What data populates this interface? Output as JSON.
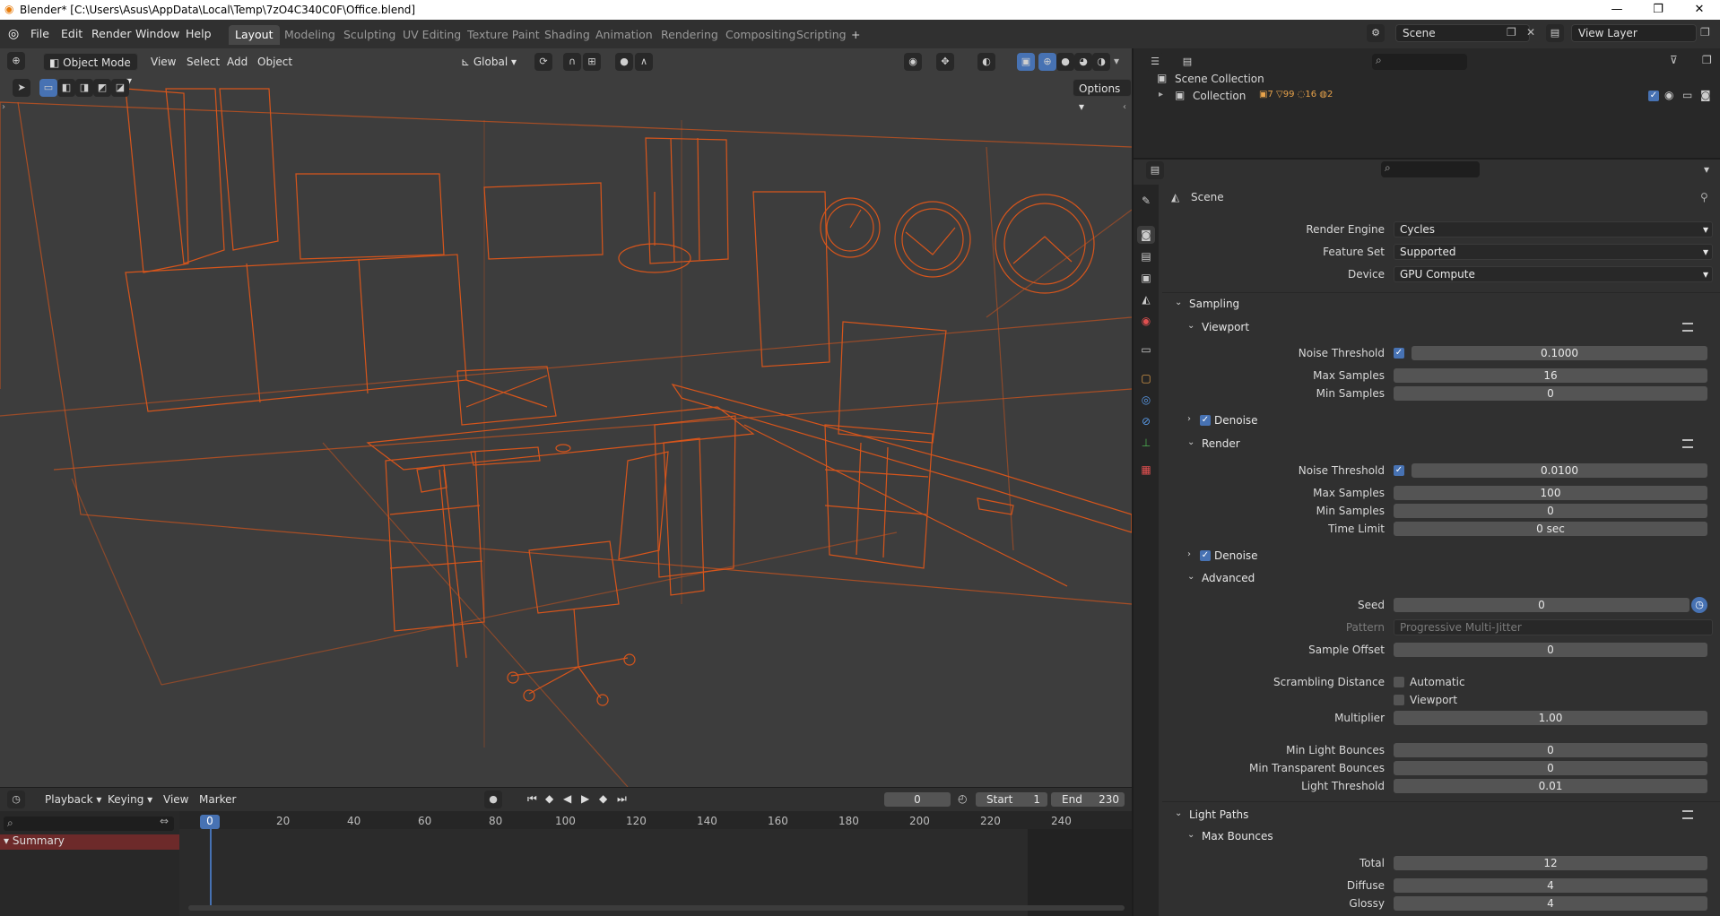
{
  "window": {
    "title": "Blender* [C:\\Users\\Asus\\AppData\\Local\\Temp\\7zO4C340C0F\\Office.blend]",
    "controls": [
      "—",
      "❐",
      "✕"
    ]
  },
  "menu": [
    "File",
    "Edit",
    "Render",
    "Window",
    "Help"
  ],
  "workspaces": [
    "Layout",
    "Modeling",
    "Sculpting",
    "UV Editing",
    "Texture Paint",
    "Shading",
    "Animation",
    "Rendering",
    "Compositing",
    "Scripting"
  ],
  "add_workspace": "+",
  "scene_selector": "Scene",
  "view_layer": "View Layer",
  "viewport": {
    "mode": "Object Mode",
    "menus": [
      "View",
      "Select",
      "Add",
      "Object"
    ],
    "transform_orientation": "Global",
    "options": "Options",
    "wire_color": "#e0571a"
  },
  "timeline": {
    "menus": [
      "Playback",
      "Keying",
      "View",
      "Marker"
    ],
    "current_frame": "0",
    "start_label": "Start",
    "start": "1",
    "end_label": "End",
    "end": "230",
    "ruler": [
      "0",
      "20",
      "40",
      "60",
      "80",
      "100",
      "120",
      "140",
      "160",
      "180",
      "200",
      "220",
      "240"
    ],
    "summary": "Summary"
  },
  "outliner": {
    "scene_collection": "Scene Collection",
    "collection": "Collection",
    "counts": [
      "7",
      "99",
      "16",
      "2"
    ]
  },
  "properties": {
    "scene": "Scene",
    "render_engine_label": "Render Engine",
    "render_engine": "Cycles",
    "feature_set_label": "Feature Set",
    "feature_set": "Supported",
    "device_label": "Device",
    "device": "GPU Compute",
    "sampling": "Sampling",
    "viewport": "Viewport",
    "noise_threshold_label": "Noise Threshold",
    "vp_noise_threshold": "0.1000",
    "max_samples_label": "Max Samples",
    "vp_max_samples": "16",
    "min_samples_label": "Min Samples",
    "vp_min_samples": "0",
    "denoise": "Denoise",
    "render": "Render",
    "r_noise_threshold": "0.0100",
    "r_max_samples": "100",
    "r_min_samples": "0",
    "time_limit_label": "Time Limit",
    "time_limit": "0 sec",
    "advanced": "Advanced",
    "seed_label": "Seed",
    "seed": "0",
    "pattern_label": "Pattern",
    "pattern": "Progressive Multi-Jitter",
    "sample_offset_label": "Sample Offset",
    "sample_offset": "0",
    "scrambling_label": "Scrambling Distance",
    "automatic": "Automatic",
    "viewport_chk": "Viewport",
    "multiplier_label": "Multiplier",
    "multiplier": "1.00",
    "min_light_bounces_label": "Min Light Bounces",
    "min_light_bounces": "0",
    "min_transparent_bounces_label": "Min Transparent Bounces",
    "min_transparent_bounces": "0",
    "light_threshold_label": "Light Threshold",
    "light_threshold": "0.01",
    "light_paths": "Light Paths",
    "max_bounces": "Max Bounces",
    "total_label": "Total",
    "total": "12",
    "diffuse_label": "Diffuse",
    "diffuse": "4",
    "glossy_label": "Glossy",
    "glossy": "4"
  }
}
